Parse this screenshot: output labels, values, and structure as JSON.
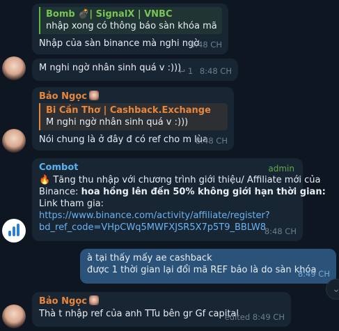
{
  "messages": {
    "m1": {
      "reply_author": "Bomb 💣| SignalX | VNBC",
      "reply_text": "nhập xong có thông báo sàn khóa mã d...",
      "text": "Nhập của sàn binance mà nghi ngờ",
      "time": "8:48 CH"
    },
    "m2": {
      "text": "M nghi ngờ nhân sinh quá v :)))",
      "reply_icon": "↩",
      "reply_count": "1",
      "time": "8:48 CH"
    },
    "m3": {
      "sender": "Bảo Ngọc",
      "reply_author": "Bi Cần Thơ | Cashback.Exchange",
      "reply_text": "M nghi ngờ nhân sinh quá v :)))",
      "text": "Nói chung là ở đây đ có ref cho m lùa",
      "time": "8:48 CH"
    },
    "m4": {
      "sender": "Combot",
      "badge": "admin",
      "emoji": "🔥",
      "line1": "Tăng thu nhập với chương trình giới thiệu/ Affiliate mới của",
      "line2_prefix": "Binance: ",
      "line2_bold": "hoa hồng lên đến 50% không giới hạn thời gian:",
      "line3": "Link tham gia:",
      "link1": "https://www.binance.com/activity/affiliate/register?",
      "link2": "bd_ref_code=VHpCWq5MWFXJSR5X7p5T9_BBLW8",
      "time": "8:48 CH"
    },
    "m5": {
      "line1": "à tại thấy mấy ae cashback",
      "line2": "được 1 thời gian lại đổi mã REF bảo là do sàn khóa",
      "time": "8:49 CH"
    },
    "m6": {
      "sender": "Bảo Ngọc",
      "text": "Thà t nhập ref của anh TTu bên gr Gf capital",
      "time": "edited 8:49 CH"
    }
  },
  "scroll_down_icon": "chevron-down-icon",
  "colors": {
    "background": "#0e1621",
    "incoming": "#182533",
    "outgoing": "#2b5278",
    "link": "#6ab3f3",
    "orange_name": "#e8873c",
    "green_name": "#79c455"
  }
}
